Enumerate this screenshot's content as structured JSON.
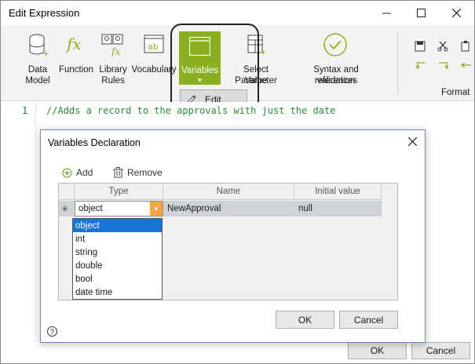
{
  "window": {
    "title": "Edit Expression"
  },
  "ribbon": {
    "items": [
      {
        "label1": "Data",
        "label2": "Model"
      },
      {
        "label1": "Function",
        "label2": ""
      },
      {
        "label1": "Library",
        "label2": "Rules"
      },
      {
        "label1": "Vocabulary",
        "label2": ""
      },
      {
        "label1": "Variables",
        "label2": ""
      },
      {
        "label1": "Select Parameter",
        "label2": "Value"
      },
      {
        "label1": "Syntax and references",
        "label2": "validation"
      }
    ],
    "variables_menu": {
      "edit_label": "Edit..."
    },
    "group_label": "Format"
  },
  "editor": {
    "line_number": "1",
    "code": "//Adds a record to the approvals with just the date"
  },
  "footer": {
    "ok_label": "OK",
    "cancel_label": "Cancel"
  },
  "dialog": {
    "title": "Variables Declaration",
    "add_label": "Add",
    "remove_label": "Remove",
    "columns": [
      "Type",
      "Name",
      "Initial value"
    ],
    "row": {
      "type": "object",
      "name": "NewApproval",
      "initial": "null"
    },
    "type_options": [
      "object",
      "int",
      "string",
      "double",
      "bool",
      "date time"
    ],
    "ok_label": "OK",
    "cancel_label": "Cancel",
    "help_label": "?"
  },
  "colors": {
    "accent_green": "#8ab020",
    "selection_blue": "#1a73d9",
    "combo_arrow": "#f4a640"
  }
}
